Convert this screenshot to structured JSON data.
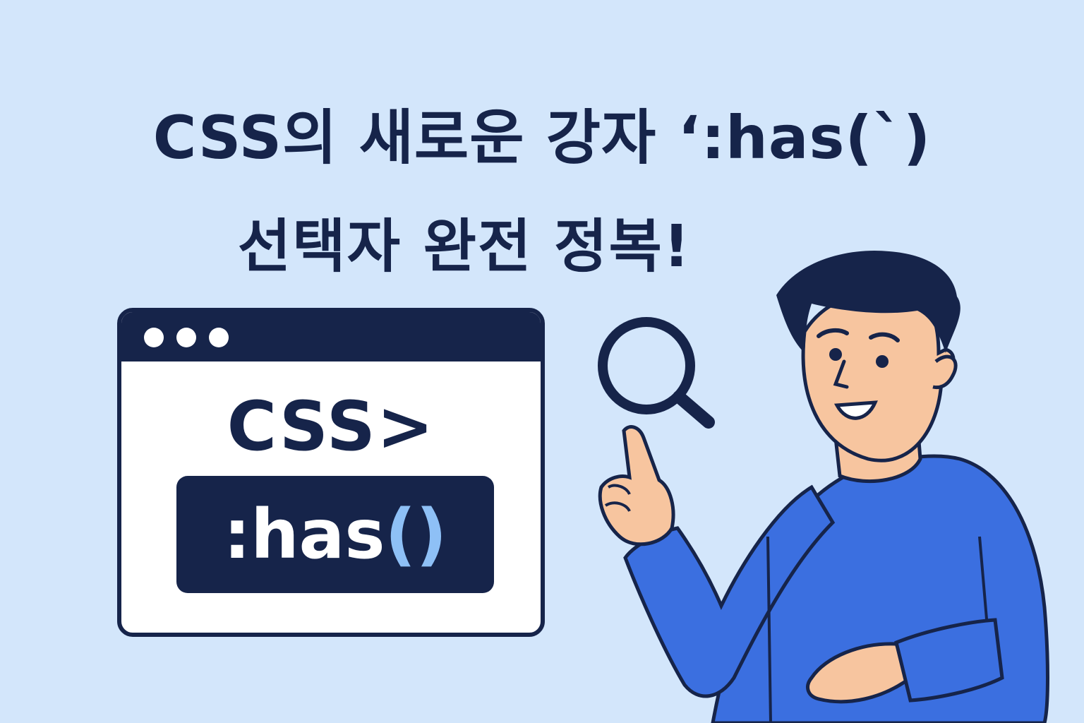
{
  "title": {
    "line1": "CSS의 새로운 강자 ‘:has(`)",
    "line2": "선택자 완전 정복!"
  },
  "browser_card": {
    "code_label": "CSS>",
    "code_pill": {
      "prefix": ":has",
      "parens": "()"
    }
  },
  "icons": {
    "window_controls": "three-dot-icon",
    "search": "magnifying-glass-icon"
  },
  "colors": {
    "background": "#d3e6fb",
    "navy": "#16244a",
    "sweater": "#3b6fe0",
    "skin": "#f7c59f",
    "accent_code": "#8ec0f6"
  }
}
